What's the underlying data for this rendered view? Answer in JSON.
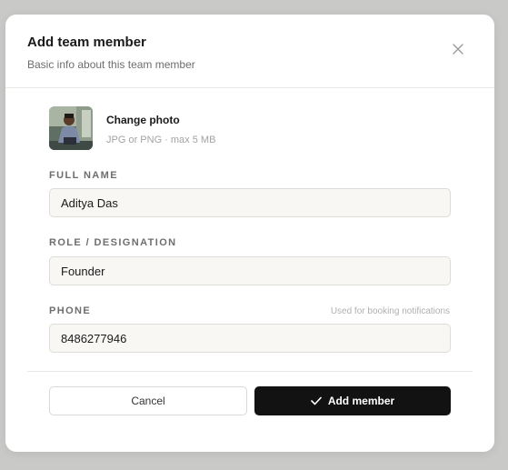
{
  "modal": {
    "title": "Add team member",
    "subtitle": "Basic info about this team member",
    "close_icon": "close-icon"
  },
  "photo": {
    "change_label": "Change photo",
    "hint": "JPG or PNG · max 5 MB",
    "avatar_icon": "avatar"
  },
  "fields": {
    "full_name": {
      "label": "FULL NAME",
      "value": "Aditya Das"
    },
    "role": {
      "label": "ROLE / DESIGNATION",
      "value": "Founder"
    },
    "phone": {
      "label": "PHONE",
      "hint": "Used for booking notifications",
      "value": "8486277946"
    }
  },
  "actions": {
    "cancel_label": "Cancel",
    "submit_label": "Add member",
    "submit_icon": "check-icon"
  },
  "colors": {
    "primary_button": "#121212",
    "input_background": "#f8f7f4",
    "backdrop": "#c9c9c7"
  }
}
